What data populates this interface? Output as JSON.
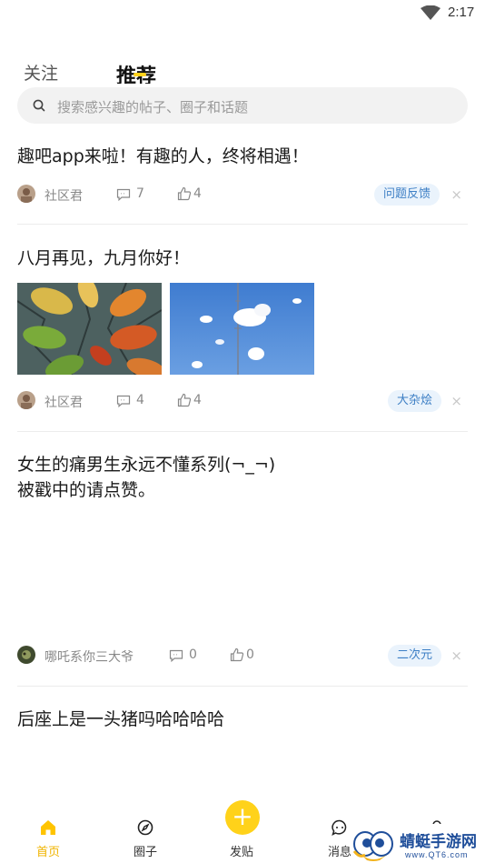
{
  "status_bar": {
    "time": "2:17",
    "wifi_icon": "wifi-icon"
  },
  "tabs": {
    "follow": "关注",
    "recommend": "推荐"
  },
  "search": {
    "placeholder": "搜索感兴趣的帖子、圈子和话题",
    "icon": "search-icon"
  },
  "posts": [
    {
      "title": "趣吧app来啦！有趣的人，终将相遇！",
      "author": "社区君",
      "comments": "7",
      "likes": "4",
      "tag": "问题反馈"
    },
    {
      "title": "八月再见，九月你好！",
      "author": "社区君",
      "comments": "4",
      "likes": "4",
      "tag": "大杂烩"
    },
    {
      "title": "女生的痛男生永远不懂系列(¬_¬)\n被戳中的请点赞。",
      "author": "哪吒系你三大爷",
      "comments": "0",
      "likes": "0",
      "tag": "二次元"
    },
    {
      "title": "后座上是一头猪吗哈哈哈哈"
    }
  ],
  "close_glyph": "×",
  "bottom_nav": {
    "home": "首页",
    "circle": "圈子",
    "publish": "发贴",
    "publish_glyph": "+",
    "messages": "消息",
    "profile": "我的"
  },
  "colors": {
    "accent": "#ffd21a",
    "tag_text": "#3d7fc5",
    "tag_bg": "#eaf3fc"
  },
  "watermark": {
    "name": "蜻蜓手游网",
    "url": "www.QT6.com"
  }
}
